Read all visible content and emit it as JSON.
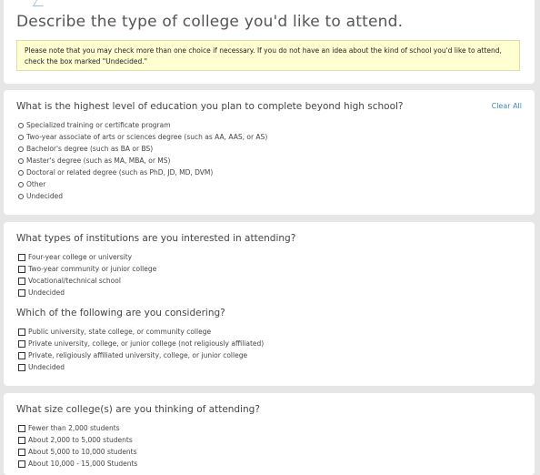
{
  "header": {
    "title": "Describe the type of college you'd like to attend.",
    "notice": "Please note that you may check more than one choice if necessary. If you do not have an idea about the kind of school you'd like to attend, check the box marked \"Undecided.\""
  },
  "education_level": {
    "question": "What is the highest level of education you plan to complete beyond high school?",
    "clear_label": "Clear All",
    "options": [
      "Specialized training or certificate program",
      "Two-year associate of arts or sciences degree (such as AA, AAS, or AS)",
      "Bachelor's degree (such as BA or BS)",
      "Master's degree (such as MA, MBA, or MS)",
      "Doctoral or related degree (such as PhD, JD, MD, DVM)",
      "Other",
      "Undecided"
    ]
  },
  "institution_types": {
    "question": "What types of institutions are you interested in attending?",
    "options": [
      "Four-year college or university",
      "Two-year community or junior college",
      "Vocational/technical school",
      "Undecided"
    ]
  },
  "considering": {
    "question": "Which of the following are you considering?",
    "options": [
      "Public university, state college, or community college",
      "Private university, college, or junior college (not religiously affiliated)",
      "Private, religiously affiliated university, college, or junior college",
      "Undecided"
    ]
  },
  "college_size": {
    "question": "What size college(s) are you thinking of attending?",
    "options": [
      "Fewer than 2,000 students",
      "About 2,000 to 5,000 students",
      "About 5,000 to 10,000 students",
      "About 10,000 - 15,000 Students"
    ]
  },
  "colors": {
    "page_bg": "#e6e6e6",
    "notice_bg": "#ffffd2",
    "link": "#3d8bbf"
  }
}
